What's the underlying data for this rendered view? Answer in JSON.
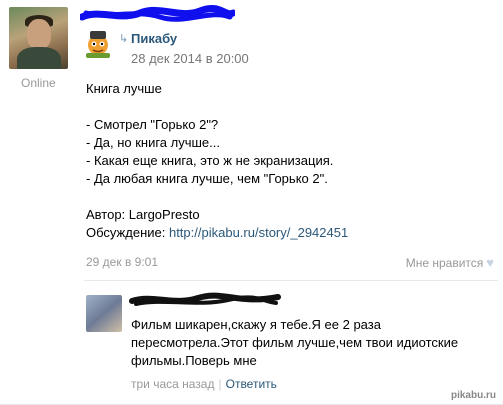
{
  "author": {
    "status": "Online"
  },
  "repost": {
    "source_name": "Пикабу",
    "date": "28 дек 2014 в 20:00"
  },
  "post": {
    "lines": [
      "Книга лучше",
      "",
      "- Смотрел \"Горько 2\"?",
      "- Да, но книга лучше...",
      "- Какая еще книга, это ж не экранизация.",
      "- Да любая книга лучше, чем \"Горько 2\".",
      ""
    ],
    "author_label": "Автор: LargoPresto",
    "discussion_label": "Обсуждение: ",
    "discussion_link": "http://pikabu.ru/story/_2942451",
    "date": "29 дек в 9:01",
    "like_label": "Мне нравится"
  },
  "comment": {
    "lines": [
      "Фильм шикарен,скажу я тебе.Я ее 2 раза",
      "пересмотрела.Этот фильм лучше,чем твои идиотские",
      "фильмы.Поверь мне"
    ],
    "time": "три часа назад",
    "reply_label": "Ответить"
  },
  "watermark": "pikabu.ru",
  "colors": {
    "link": "#2b587a",
    "muted": "#999999",
    "scribble": "#1010ee"
  },
  "icons": {
    "repost": "repost-arrow-icon",
    "like": "heart-icon"
  }
}
